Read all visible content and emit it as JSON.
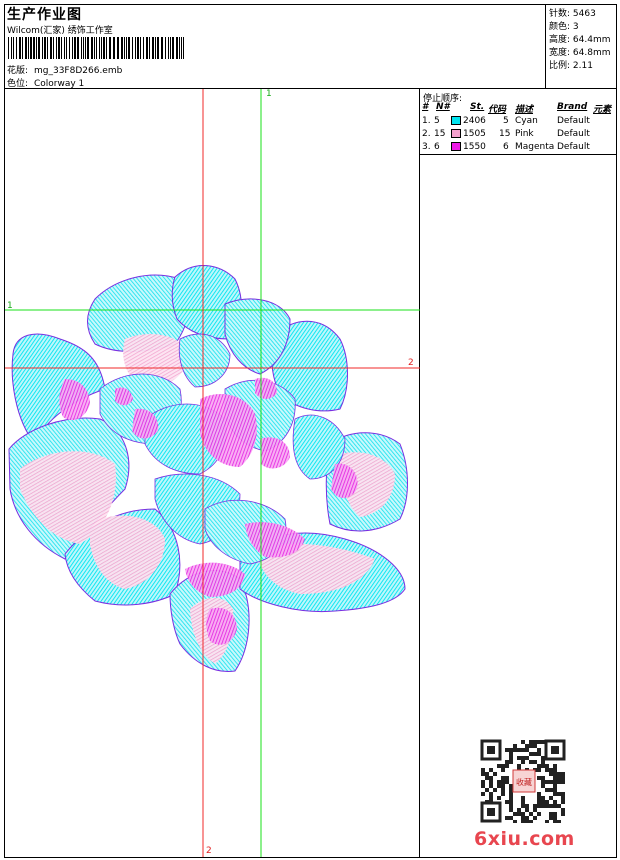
{
  "header": {
    "title": "生产作业图",
    "company": "Wilcom(汇家) 绣饰工作室",
    "design_label": "花版:",
    "design_file": "mg_33F8D266.emb",
    "colorway_label": "色位:",
    "colorway_value": "Colorway 1"
  },
  "stats": {
    "stitches_label": "针数:",
    "stitches": "5463",
    "colors_label": "颜色:",
    "colors": "3",
    "height_label": "高度:",
    "height": "64.4mm",
    "width_label": "宽度:",
    "width": "64.8mm",
    "ratio_label": "比例:",
    "ratio": "2.11"
  },
  "sequence": {
    "title": "停止顺序:",
    "headers": [
      "#",
      "N#",
      "St.",
      "代码",
      "描述",
      "Brand",
      "元素"
    ],
    "rows": [
      {
        "idx": "1.",
        "n": "5",
        "color": "#00e5f0",
        "st": "2406",
        "code": "5",
        "desc": "Cyan",
        "brand": "Default"
      },
      {
        "idx": "2.",
        "n": "15",
        "color": "#f5a0cd",
        "st": "1505",
        "code": "15",
        "desc": "Pink",
        "brand": "Default"
      },
      {
        "idx": "3.",
        "n": "6",
        "color": "#ee18e6",
        "st": "1550",
        "code": "6",
        "desc": "Magenta",
        "brand": "Default"
      }
    ]
  },
  "axes": {
    "v1": "1",
    "h1": "1",
    "h2": "2",
    "v2": "2"
  },
  "watermark": "6xiu.com",
  "qr_stamp": "收藏"
}
